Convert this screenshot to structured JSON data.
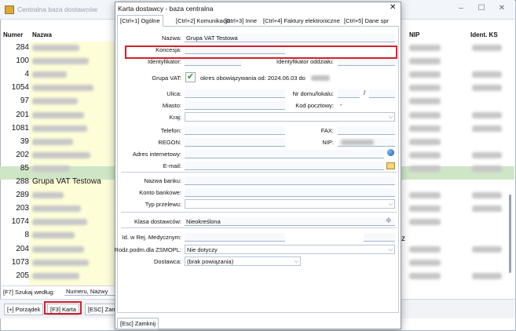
{
  "background_window": {
    "title": "Centralna baza dostawców",
    "columns": {
      "numer": "Numer",
      "nazwa": "Nazwa",
      "nip": "NIP",
      "ident": "Ident. KS"
    },
    "rows": [
      "284",
      "100",
      "4",
      "1054",
      "97",
      "201",
      "1081",
      "39",
      "202",
      "85",
      "288",
      "289",
      "203",
      "1074",
      "8",
      "204",
      "1073",
      "205"
    ],
    "selected_row": {
      "numer": "288",
      "nazwa": "Grupa VAT Testowa"
    },
    "search_label": "[F7] Szukaj według:",
    "search_value": "Numeru, Nazwy",
    "buttons": {
      "porzadek": "[+] Porządek",
      "karta": "[F3] Karta",
      "zamknij": "[ESC] Zamk"
    },
    "right_z": "z"
  },
  "dialog": {
    "title": "Karta dostawcy - baza centralna",
    "tabs": [
      "[Ctrl+1] Ogólne",
      "[Ctrl+2] Komunikacja",
      "[Ctrl+3] Inne",
      "[Ctrl+4] Faktury elektroniczne",
      "[Ctrl+5] Dane spr"
    ],
    "labels": {
      "nazwa": "Nazwa:",
      "koncesja": "Koncesja:",
      "identyfikator": "Identyfikator:",
      "identyfikator_oddzialu": "Identyfikator oddziału:",
      "grupa_vat": "Grupa VAT:",
      "ulica": "Ulica:",
      "nr_domu": "Nr domu/lokalu:",
      "miasto": "Miasto:",
      "kod_pocztowy": "Kod pocztowy:",
      "kraj": "Kraj:",
      "telefon": "Telefon:",
      "fax": "FAX:",
      "regon": "REGON:",
      "nip": "NIP:",
      "adres_www": "Adres internetowy:",
      "email": "E-mail:",
      "nazwa_banku": "Nazwa banku:",
      "konto": "Konto bankowe:",
      "typ_przelewu": "Typ przelewu:",
      "klasa": "Klasa dostawców:",
      "rej_med": "Id. w Rej. Medycznym:",
      "rodz_podm": "Rodz.podm.dla ZSMOPL:",
      "dostawca": "Dostawca:"
    },
    "values": {
      "nazwa": "Grupa VAT Testowa",
      "grupa_vat_text": "okres obowiązywania od: 2024.06.03 do",
      "nr_slash": "/",
      "kod_dash": "-",
      "klasa": "Nieokreślona",
      "rodz_podm": "Nie dotyczy",
      "dostawca": "(brak powiązania)"
    },
    "close_button": "[Esc] Zamknij"
  },
  "colors": {
    "highlight_red": "#d4202a",
    "selected_row": "#cfe6c6",
    "yellow_col": "#fdfdd8"
  }
}
